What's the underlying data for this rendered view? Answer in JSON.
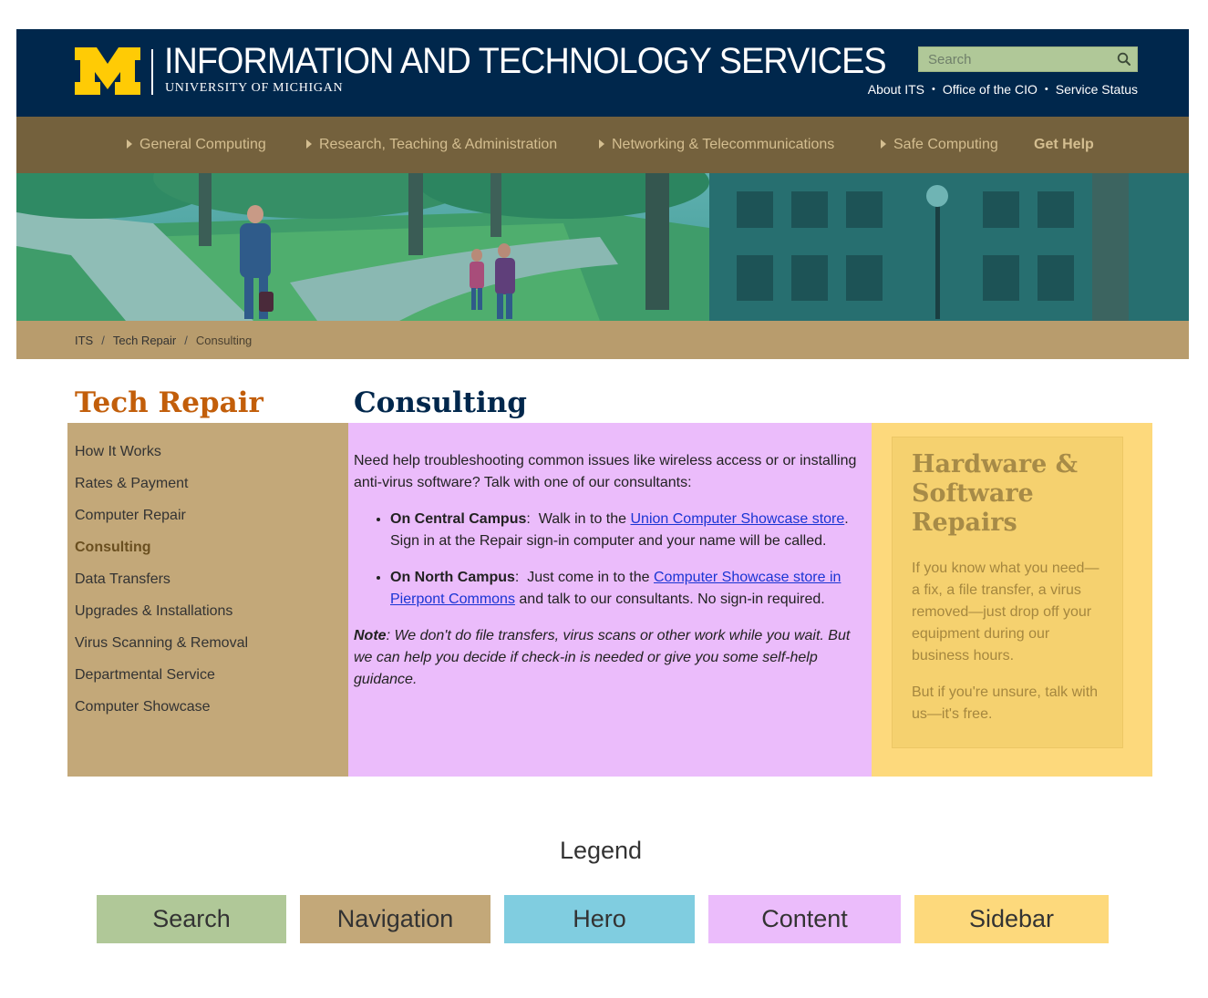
{
  "header": {
    "title": "INFORMATION AND TECHNOLOGY SERVICES",
    "subtitle": "UNIVERSITY OF MICHIGAN",
    "search": {
      "placeholder": "Search"
    },
    "utility_links": [
      "About ITS",
      "Office of the CIO",
      "Service Status"
    ],
    "colors": {
      "header_bg": "#00274c",
      "maize": "#ffcb05",
      "search_bg": "#b0c898"
    }
  },
  "nav": {
    "items": [
      {
        "label": "General Computing"
      },
      {
        "label": "Research, Teaching & Administration"
      },
      {
        "label": "Networking & Telecommunications"
      },
      {
        "label": "Safe Computing"
      },
      {
        "label": "Get Help"
      }
    ],
    "bg_color": "#74613d"
  },
  "breadcrumb": [
    "ITS",
    "Tech Repair",
    "Consulting"
  ],
  "section_title": "Tech Repair",
  "page_title": "Consulting",
  "side_nav": {
    "items": [
      {
        "label": "How It Works",
        "active": false
      },
      {
        "label": "Rates & Payment",
        "active": false
      },
      {
        "label": "Computer Repair",
        "active": false
      },
      {
        "label": "Consulting",
        "active": true
      },
      {
        "label": "Data Transfers",
        "active": false
      },
      {
        "label": "Upgrades & Installations",
        "active": false
      },
      {
        "label": "Virus Scanning & Removal",
        "active": false
      },
      {
        "label": "Departmental Service",
        "active": false
      },
      {
        "label": "Computer Showcase",
        "active": false
      }
    ]
  },
  "content": {
    "intro": "Need help troubleshooting common issues like wireless access or or installing anti-virus software? Talk with one of our consultants:",
    "central": {
      "label": "On Central Campus",
      "text1": "Walk in to the",
      "link": "Union Computer Showcase store",
      "text2": ". Sign in at the Repair sign-in computer and your name will be called."
    },
    "north": {
      "label": "On North Campus",
      "text1": "Just come in to the",
      "link": "Computer Showcase store in Pierpont Commons",
      "text2": "and talk to our consultants. No sign-in required."
    },
    "note_label": "Note",
    "note_text": ": We don't do file transfers, virus scans or other work while you wait. But we can help you decide if check-in is needed or give you some self-help guidance."
  },
  "sidebar": {
    "title": "Hardware & Software Repairs",
    "p1": "If you know what you need—a fix, a file transfer, a virus removed—just drop off your equipment during our business hours.",
    "p2": "But if you're unsure, talk with us—it's free."
  },
  "legend": {
    "title": "Legend",
    "items": [
      {
        "label": "Search",
        "color": "#b0c898"
      },
      {
        "label": "Navigation",
        "color": "#c3a879"
      },
      {
        "label": "Hero",
        "color": "#80cde0"
      },
      {
        "label": "Content",
        "color": "#ebbcfb"
      },
      {
        "label": "Sidebar",
        "color": "#fdd97c"
      }
    ]
  }
}
